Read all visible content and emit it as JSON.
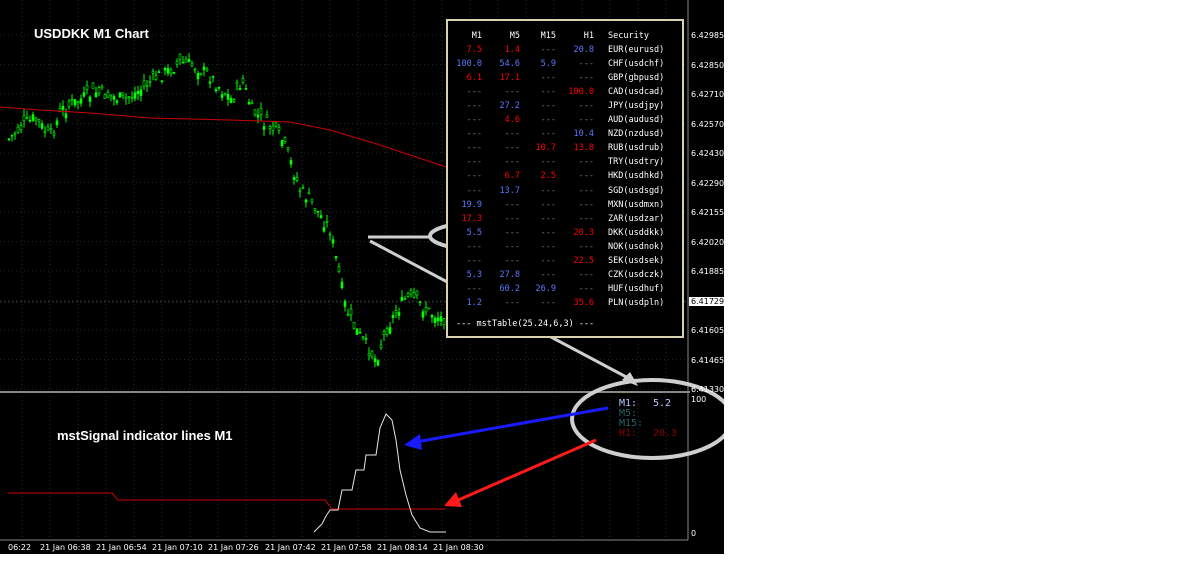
{
  "chart": {
    "title": "USDDKK M1 Chart",
    "indicator_title": "mstSignal indicator lines   M1",
    "price_axis": [
      "6.42985",
      "6.42850",
      "6.42710",
      "6.42570",
      "6.42430",
      "6.42290",
      "6.42155",
      "6.42020",
      "6.41885",
      "6.41745",
      "6.41605",
      "6.41465",
      "6.41330"
    ],
    "current_price": "6.41729",
    "indicator_axis": [
      "100",
      "0"
    ],
    "time_axis": [
      "06:22",
      "21 Jan 06:38",
      "21 Jan 06:54",
      "21 Jan 07:10",
      "21 Jan 07:26",
      "21 Jan 07:42",
      "21 Jan 07:58",
      "21 Jan 08:14",
      "21 Jan 08:30"
    ],
    "colors": {
      "background": "#000000",
      "candle": "#00ff00",
      "ma": "#cc0000",
      "grid": "#2f4f4f",
      "table_border": "#d8d2b0",
      "blue_value": "#5a78ff",
      "red_value": "#ff0000",
      "blue_arrow": "#0000ff",
      "red_arrow": "#ff0000"
    }
  },
  "table": {
    "headers": [
      "M1",
      "M5",
      "M15",
      "H1",
      "Security"
    ],
    "rows": [
      {
        "m1": "7.5",
        "m1c": "r",
        "m5": "1.4",
        "m5c": "r",
        "m15": "---",
        "m15c": "g",
        "h1": "20.8",
        "h1c": "b",
        "security": "EUR(eurusd)"
      },
      {
        "m1": "100.0",
        "m1c": "b",
        "m5": "54.6",
        "m5c": "b",
        "m15": "5.9",
        "m15c": "b",
        "h1": "---",
        "h1c": "g",
        "security": "CHF(usdchf)"
      },
      {
        "m1": "6.1",
        "m1c": "r",
        "m5": "17.1",
        "m5c": "r",
        "m15": "---",
        "m15c": "g",
        "h1": "---",
        "h1c": "g",
        "security": "GBP(gbpusd)"
      },
      {
        "m1": "---",
        "m1c": "g",
        "m5": "---",
        "m5c": "g",
        "m15": "---",
        "m15c": "g",
        "h1": "100.0",
        "h1c": "r",
        "security": "CAD(usdcad)"
      },
      {
        "m1": "---",
        "m1c": "g",
        "m5": "27.2",
        "m5c": "b",
        "m15": "---",
        "m15c": "g",
        "h1": "---",
        "h1c": "g",
        "security": "JPY(usdjpy)"
      },
      {
        "m1": "---",
        "m1c": "g",
        "m5": "4.6",
        "m5c": "r",
        "m15": "---",
        "m15c": "g",
        "h1": "---",
        "h1c": "g",
        "security": "AUD(audusd)"
      },
      {
        "m1": "---",
        "m1c": "g",
        "m5": "---",
        "m5c": "g",
        "m15": "---",
        "m15c": "g",
        "h1": "10.4",
        "h1c": "b",
        "security": "NZD(nzdusd)"
      },
      {
        "m1": "---",
        "m1c": "g",
        "m5": "---",
        "m5c": "g",
        "m15": "10.7",
        "m15c": "r",
        "h1": "13.8",
        "h1c": "r",
        "security": "RUB(usdrub)"
      },
      {
        "m1": "---",
        "m1c": "g",
        "m5": "---",
        "m5c": "g",
        "m15": "---",
        "m15c": "g",
        "h1": "---",
        "h1c": "g",
        "security": "TRY(usdtry)"
      },
      {
        "m1": "---",
        "m1c": "g",
        "m5": "6.7",
        "m5c": "r",
        "m15": "2.5",
        "m15c": "r",
        "h1": "---",
        "h1c": "g",
        "security": "HKD(usdhkd)"
      },
      {
        "m1": "---",
        "m1c": "g",
        "m5": "13.7",
        "m5c": "b",
        "m15": "---",
        "m15c": "g",
        "h1": "---",
        "h1c": "g",
        "security": "SGD(usdsgd)"
      },
      {
        "m1": "19.9",
        "m1c": "b",
        "m5": "---",
        "m5c": "g",
        "m15": "---",
        "m15c": "g",
        "h1": "---",
        "h1c": "g",
        "security": "MXN(usdmxn)"
      },
      {
        "m1": "17.3",
        "m1c": "r",
        "m5": "---",
        "m5c": "g",
        "m15": "---",
        "m15c": "g",
        "h1": "---",
        "h1c": "g",
        "security": "ZAR(usdzar)"
      },
      {
        "m1": "5.5",
        "m1c": "b",
        "m5": "---",
        "m5c": "g",
        "m15": "---",
        "m15c": "g",
        "h1": "20.3",
        "h1c": "r",
        "security": "DKK(usddkk)"
      },
      {
        "m1": "---",
        "m1c": "g",
        "m5": "---",
        "m5c": "g",
        "m15": "---",
        "m15c": "g",
        "h1": "---",
        "h1c": "g",
        "security": "NOK(usdnok)"
      },
      {
        "m1": "---",
        "m1c": "g",
        "m5": "---",
        "m5c": "g",
        "m15": "---",
        "m15c": "g",
        "h1": "22.5",
        "h1c": "r",
        "security": "SEK(usdsek)"
      },
      {
        "m1": "5.3",
        "m1c": "b",
        "m5": "27.8",
        "m5c": "b",
        "m15": "---",
        "m15c": "g",
        "h1": "---",
        "h1c": "g",
        "security": "CZK(usdczk)"
      },
      {
        "m1": "---",
        "m1c": "g",
        "m5": "60.2",
        "m5c": "b",
        "m15": "26.9",
        "m15c": "b",
        "h1": "---",
        "h1c": "g",
        "security": "HUF(usdhuf)"
      },
      {
        "m1": "1.2",
        "m1c": "b",
        "m5": "---",
        "m5c": "g",
        "m15": "---",
        "m15c": "g",
        "h1": "35.6",
        "h1c": "r",
        "security": "PLN(usdpln)"
      }
    ],
    "footer": "--- mstTable(25.24,6,3) ---"
  },
  "signal": {
    "lines": [
      {
        "label": "M1:",
        "value": "5.2",
        "color": "#b4c8ff"
      },
      {
        "label": "M5:",
        "value": "",
        "color": "#2f5f5f"
      },
      {
        "label": "M15:",
        "value": "",
        "color": "#2f5f5f"
      },
      {
        "label": "H1:",
        "value": "20.3",
        "color": "#8b0000"
      }
    ]
  }
}
